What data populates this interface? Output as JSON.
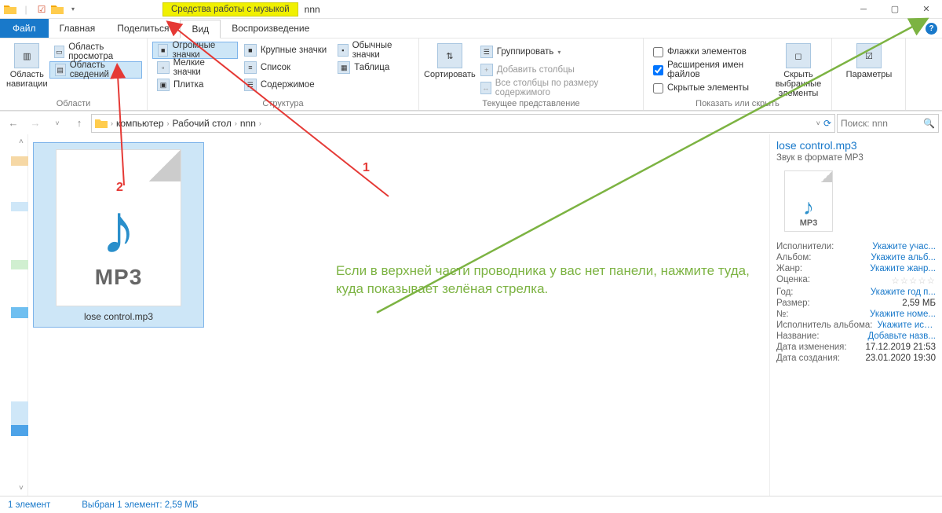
{
  "title": {
    "context_tab": "Средства работы с музыкой",
    "window": "nnn"
  },
  "tabs": {
    "file": "Файл",
    "home": "Главная",
    "share": "Поделиться",
    "view": "Вид",
    "play": "Воспроизведение"
  },
  "ribbon": {
    "panes_group": "Области",
    "nav_pane": "Область навигации",
    "preview_pane": "Область просмотра",
    "details_pane": "Область сведений",
    "layout_group": "Структура",
    "layouts": {
      "huge": "Огромные значки",
      "large": "Крупные значки",
      "medium": "Обычные значки",
      "small": "Мелкие значки",
      "list": "Список",
      "details": "Таблица",
      "tiles": "Плитка",
      "content": "Содержимое"
    },
    "sort_btn": "Сортировать",
    "current_view_group": "Текущее представление",
    "group_by": "Группировать",
    "add_columns": "Добавить столбцы",
    "size_all": "Все столбцы по размеру содержимого",
    "chk_item_boxes": "Флажки элементов",
    "chk_extensions": "Расширения имен файлов",
    "chk_hidden": "Скрытые элементы",
    "show_hide_group": "Показать или скрыть",
    "hide_selected": "Скрыть выбранные элементы",
    "options": "Параметры"
  },
  "breadcrumb": {
    "pc": "компьютер",
    "desktop": "Рабочий стол",
    "folder": "nnn"
  },
  "search_placeholder": "Поиск: nnn",
  "file": {
    "name": "lose control.mp3",
    "thumb_label": "MP3"
  },
  "details": {
    "title": "lose control.mp3",
    "type": "Звук в формате MP3",
    "props": {
      "artists_k": "Исполнители:",
      "artists_v": "Укажите учас...",
      "album_k": "Альбом:",
      "album_v": "Укажите альб...",
      "genre_k": "Жанр:",
      "genre_v": "Укажите жанр...",
      "rating_k": "Оценка:",
      "year_k": "Год:",
      "year_v": "Укажите год п...",
      "size_k": "Размер:",
      "size_v": "2,59 МБ",
      "track_k": "№:",
      "track_v": "Укажите номе...",
      "albumartist_k": "Исполнитель альбома:",
      "albumartist_v": "Укажите испо...",
      "title_k": "Название:",
      "title_v": "Добавьте назв...",
      "modified_k": "Дата изменения:",
      "modified_v": "17.12.2019 21:53",
      "created_k": "Дата создания:",
      "created_v": "23.01.2020 19:30"
    }
  },
  "status": {
    "count": "1 элемент",
    "selected": "Выбран 1 элемент: 2,59 МБ"
  },
  "annotations": {
    "num1": "1",
    "num2": "2",
    "hint": "Если в верхней части проводника у вас нет панели, нажмите туда, куда показывает зелёная стрелка."
  }
}
